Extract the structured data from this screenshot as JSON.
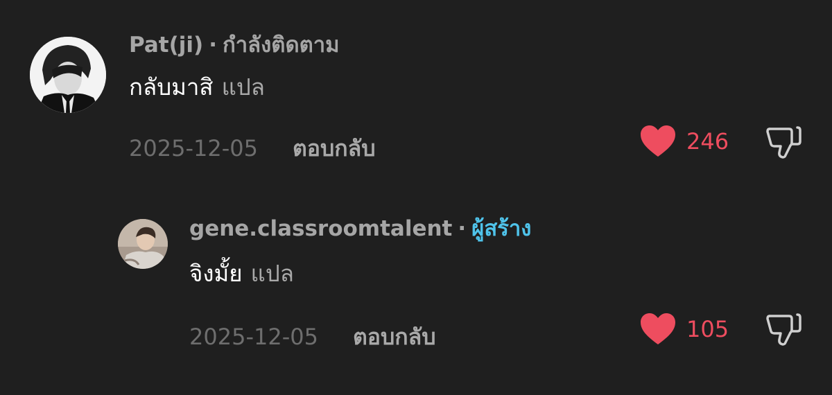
{
  "colors": {
    "background": "#1f1f1f",
    "like_red": "#ee4d5f",
    "creator_blue": "#4fc3ea",
    "muted_text": "#a6a6a6"
  },
  "comments": [
    {
      "username": "Pat(ji)",
      "separator": "·",
      "tag": "กำลังติดตาม",
      "text": "กลับมาสิ",
      "translate": "แปล",
      "date": "2025-12-05",
      "reply": "ตอบกลับ",
      "likes": "246",
      "like_icon": "heart-filled-icon",
      "dislike_icon": "thumbs-down-icon"
    },
    {
      "username": "gene.classroomtalent",
      "separator": "·",
      "tag": "ผู้สร้าง",
      "text": "จิงมั้ย",
      "translate": "แปล",
      "date": "2025-12-05",
      "reply": "ตอบกลับ",
      "likes": "105",
      "like_icon": "heart-filled-icon",
      "dislike_icon": "thumbs-down-icon"
    }
  ]
}
